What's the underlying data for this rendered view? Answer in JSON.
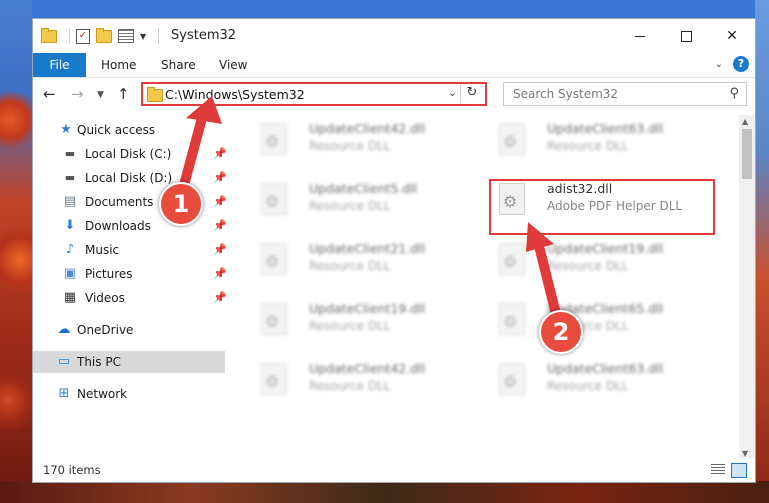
{
  "window": {
    "title": "System32",
    "colors": {
      "accent": "#1979ca",
      "annotation": "#e03a3a",
      "selection": "#d9d9d9"
    }
  },
  "ribbon": {
    "tabs": [
      {
        "label": "File"
      },
      {
        "label": "Home"
      },
      {
        "label": "Share"
      },
      {
        "label": "View"
      }
    ],
    "help_label": "?"
  },
  "nav": {
    "address": "C:\\Windows\\System32",
    "search_placeholder": "Search System32"
  },
  "sidebar": {
    "items": [
      {
        "label": "Quick access",
        "icon": "star-icon",
        "pinned": false
      },
      {
        "label": "Local Disk (C:)",
        "icon": "drive-icon",
        "pinned": true
      },
      {
        "label": "Local Disk (D:)",
        "icon": "drive-icon",
        "pinned": true
      },
      {
        "label": "Documents",
        "icon": "documents-icon",
        "pinned": true
      },
      {
        "label": "Downloads",
        "icon": "downloads-icon",
        "pinned": true
      },
      {
        "label": "Music",
        "icon": "music-icon",
        "pinned": true
      },
      {
        "label": "Pictures",
        "icon": "pictures-icon",
        "pinned": true
      },
      {
        "label": "Videos",
        "icon": "videos-icon",
        "pinned": true
      },
      {
        "label": "OneDrive",
        "icon": "cloud-icon",
        "pinned": false
      },
      {
        "label": "This PC",
        "icon": "computer-icon",
        "pinned": false,
        "selected": true
      },
      {
        "label": "Network",
        "icon": "network-icon",
        "pinned": false
      }
    ]
  },
  "files": {
    "left_column": [
      {
        "name": "UpdateClient42.dll",
        "type": "Resource DLL"
      },
      {
        "name": "UpdateClient5.dll",
        "type": "Resource DLL"
      },
      {
        "name": "UpdateClient21.dll",
        "type": "Resource DLL"
      },
      {
        "name": "UpdateClient19.dll",
        "type": "Resource DLL"
      },
      {
        "name": "UpdateClient42.dll",
        "type": "Resource DLL"
      }
    ],
    "right_column": [
      {
        "name": "UpdateClient63.dll",
        "type": "Resource DLL"
      },
      {
        "name": "adist32.dll",
        "type": "Adobe PDF Helper DLL",
        "highlighted": true
      },
      {
        "name": "UpdateClient19.dll",
        "type": "Resource DLL"
      },
      {
        "name": "UpdateClient65.dll",
        "type": "Resource DLL"
      },
      {
        "name": "UpdateClient63.dll",
        "type": "Resource DLL"
      }
    ]
  },
  "status": {
    "item_count": "170 items"
  },
  "annotations": {
    "step1": "1",
    "step2": "2"
  }
}
